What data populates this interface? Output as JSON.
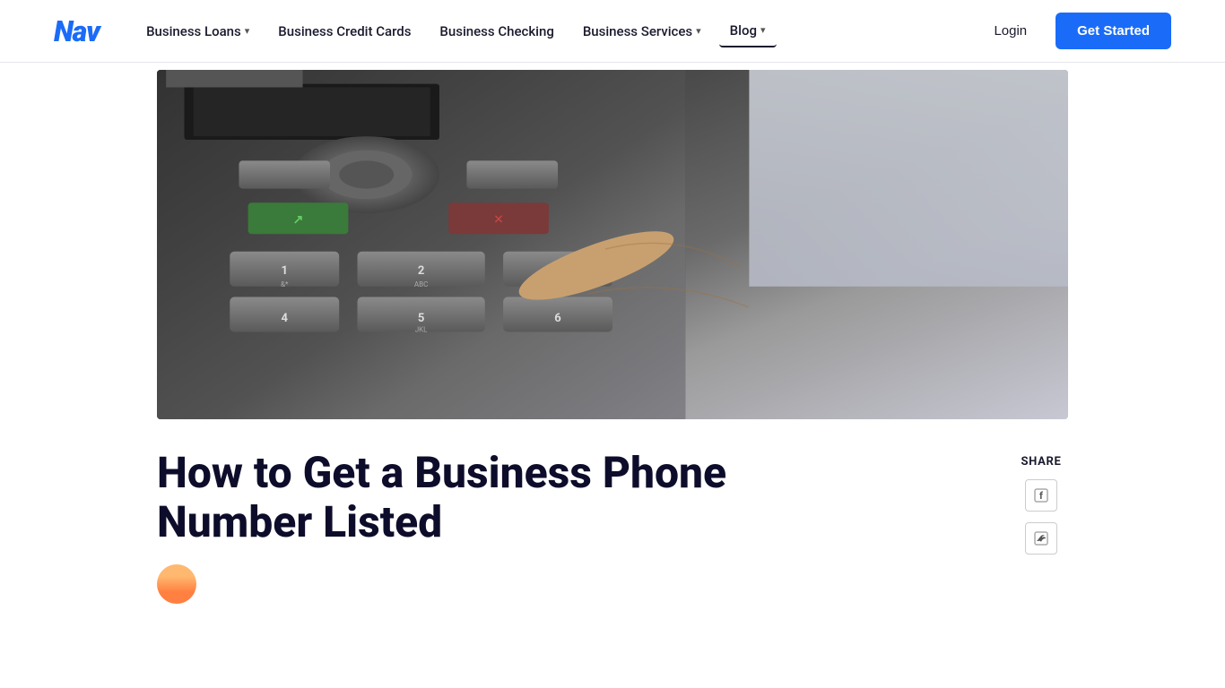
{
  "brand": {
    "logo": "Nav"
  },
  "nav": {
    "items": [
      {
        "label": "Business Loans",
        "has_dropdown": true,
        "active": false
      },
      {
        "label": "Business Credit Cards",
        "has_dropdown": false,
        "active": false
      },
      {
        "label": "Business Checking",
        "has_dropdown": false,
        "active": false
      },
      {
        "label": "Business Services",
        "has_dropdown": true,
        "active": false
      },
      {
        "label": "Blog",
        "has_dropdown": true,
        "active": true
      }
    ],
    "login_label": "Login",
    "get_started_label": "Get Started"
  },
  "article": {
    "title": "How to Get a Business Phone Number Listed",
    "hero_alt": "Close-up of a hand pressing buttons on a phone keypad"
  },
  "share": {
    "label": "SHARE",
    "icons": [
      {
        "name": "facebook",
        "glyph": "f"
      },
      {
        "name": "twitter",
        "glyph": "t"
      }
    ]
  }
}
